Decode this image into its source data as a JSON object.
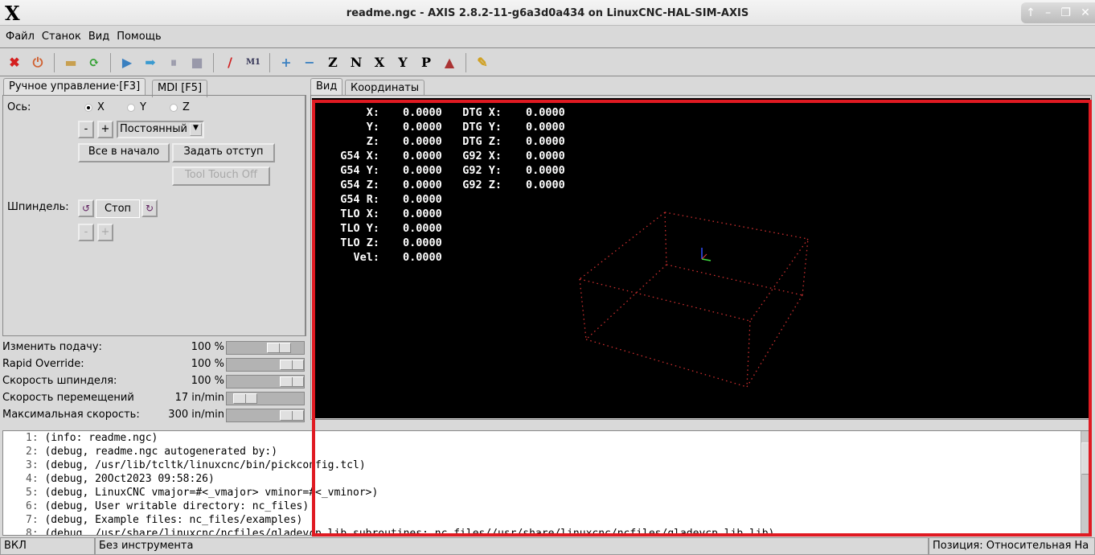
{
  "window": {
    "title": "readme.ngc - AXIS 2.8.2-11-g6a3d0a434 on LinuxCNC-HAL-SIM-AXIS",
    "logo": "X",
    "controls": [
      "↑",
      "–",
      "❐",
      "✕"
    ]
  },
  "menu": [
    "Файл",
    "Станок",
    "Вид",
    "Помощь"
  ],
  "toolbar": [
    {
      "icon": "estop-icon",
      "glyph": "✖",
      "color": "#d42020"
    },
    {
      "icon": "power-icon",
      "glyph": "⏻",
      "color": "#d06030"
    },
    {
      "sep": true
    },
    {
      "icon": "open-folder-icon",
      "glyph": "▬",
      "color": "#c8a050"
    },
    {
      "icon": "reload-icon",
      "glyph": "⟳",
      "color": "#30a030"
    },
    {
      "sep": true
    },
    {
      "icon": "run-icon",
      "glyph": "▶",
      "color": "#3a80c0"
    },
    {
      "icon": "step-icon",
      "glyph": "➡",
      "color": "#3a9ad0"
    },
    {
      "icon": "pause-icon",
      "glyph": "⏸",
      "color": "#99a"
    },
    {
      "icon": "stop-icon",
      "glyph": "■",
      "color": "#99a"
    },
    {
      "sep": true
    },
    {
      "icon": "block-delete-icon",
      "glyph": "/",
      "color": "#d02020"
    },
    {
      "icon": "optional-stop-icon",
      "glyph": "M1",
      "color": "#335"
    },
    {
      "sep": true
    },
    {
      "icon": "zoom-in-icon",
      "glyph": "+",
      "color": "#3a80c0"
    },
    {
      "icon": "zoom-out-icon",
      "glyph": "−",
      "color": "#3a80c0"
    },
    {
      "icon": "view-z-icon",
      "glyph": "Z",
      "color": "#000"
    },
    {
      "icon": "view-z2-icon",
      "glyph": "N",
      "color": "#000"
    },
    {
      "icon": "view-x-icon",
      "glyph": "X",
      "color": "#000"
    },
    {
      "icon": "view-y-icon",
      "glyph": "Y",
      "color": "#000"
    },
    {
      "icon": "view-p-icon",
      "glyph": "P",
      "color": "#000"
    },
    {
      "icon": "rotate-icon",
      "glyph": "▲",
      "color": "#a33"
    },
    {
      "sep": true
    },
    {
      "icon": "clear-plot-icon",
      "glyph": "✎",
      "color": "#d0a020"
    }
  ],
  "left_tabs": [
    "Ручное управление·[F3]",
    "MDI [F5]"
  ],
  "manual": {
    "axis_label": "Ось:",
    "axes": [
      "X",
      "Y",
      "Z"
    ],
    "selected_axis": "X",
    "minus": "-",
    "plus": "+",
    "jog_mode": "Постоянный",
    "home_all": "Все в начало",
    "touch_off": "Задать отступ",
    "tool_touch_off": "Tool Touch Off",
    "spindle_label": "Шпиндель:",
    "spindle_stop": "Стоп",
    "spindle_minus": "-",
    "spindle_plus": "+"
  },
  "sliders": [
    {
      "label": "Изменить подачу:",
      "value": "100 %",
      "fraction": 0.75
    },
    {
      "label": "Rapid Override:",
      "value": "100 %",
      "fraction": 1.0
    },
    {
      "label": "Скорость шпинделя:",
      "value": "100 %",
      "fraction": 1.0
    },
    {
      "label": "Скорость перемещений",
      "value": "17 in/min",
      "fraction": 0.12
    },
    {
      "label": "Максимальная скорость:",
      "value": "300 in/min",
      "fraction": 1.0
    }
  ],
  "right_tabs": [
    "Вид",
    "Координаты"
  ],
  "dro": [
    [
      "X:",
      "0.0000",
      "DTG X:",
      "0.0000"
    ],
    [
      "Y:",
      "0.0000",
      "DTG Y:",
      "0.0000"
    ],
    [
      "Z:",
      "0.0000",
      "DTG Z:",
      "0.0000"
    ],
    [
      "G54 X:",
      "0.0000",
      "G92 X:",
      "0.0000"
    ],
    [
      "G54 Y:",
      "0.0000",
      "G92 Y:",
      "0.0000"
    ],
    [
      "G54 Z:",
      "0.0000",
      "G92 Z:",
      "0.0000"
    ],
    [
      "G54 R:",
      "0.0000",
      "",
      ""
    ],
    [
      "TLO X:",
      "0.0000",
      "",
      ""
    ],
    [
      "TLO Y:",
      "0.0000",
      "",
      ""
    ],
    [
      "TLO Z:",
      "0.0000",
      "",
      ""
    ],
    [
      "Vel:",
      "0.0000",
      "",
      ""
    ]
  ],
  "colors": {
    "limits_box": "#d03030",
    "annotation": "#e01a22",
    "view_bg": "#000000"
  },
  "gcode": [
    {
      "n": "1:",
      "text": "(info: readme.ngc)"
    },
    {
      "n": "2:",
      "text": "(debug, readme.ngc autogenerated by:)"
    },
    {
      "n": "3:",
      "text": "(debug, /usr/lib/tcltk/linuxcnc/bin/pickconfig.tcl)"
    },
    {
      "n": "4:",
      "text": "(debug, 20Oct2023 09:58:26)"
    },
    {
      "n": "5:",
      "text": "(debug, LinuxCNC vmajor=#<_vmajor> vminor=#<_vminor>)"
    },
    {
      "n": "6:",
      "text": "(debug, User writable directory: nc_files)"
    },
    {
      "n": "7:",
      "text": "(debug, Example files: nc_files/examples)"
    },
    {
      "n": "8:",
      "text": "(debug, /usr/share/linuxcnc/ncfiles/gladevcp_lib_subroutines: nc_files//usr/share/linuxcnc/ncfiles/gladevcp_lib.lib)"
    }
  ],
  "status": {
    "state": "ВКЛ",
    "tool": "Без инструмента",
    "position": "Позиция: Относительная На"
  }
}
